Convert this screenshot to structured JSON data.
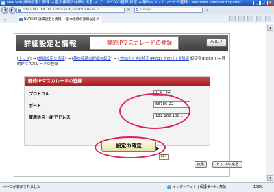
{
  "window": {
    "title": "NVR500 詳細設定と情報 → 基本接続の詳細な設定 → プロバイダの登録/修正 → 静的IPマスカレードの登録 - Windows Internet Explorer",
    "min": "_",
    "max": "□",
    "close": "×"
  },
  "addressbar": {
    "url": "http://192.168.100.1/detail/nat_addstrt?AHA3S=S",
    "search_placeholder": "Google",
    "search_glyph": "G"
  },
  "tab": {
    "label": "NVR500 詳細設定と情報 → 基本接続の詳細な設...",
    "close": "×"
  },
  "page": {
    "header_title": "詳細設定と情報",
    "header_subtitle": "静的IPマスカレードの登録",
    "help_label": "ヘルプ",
    "breadcrumb": {
      "open": "[",
      "top": "トップ",
      "sep1": "] → [",
      "detail": "詳細設定と情報",
      "sep2": "] → [",
      "basic": "基本接続の詳細な設定",
      "sep3": "] → [",
      "provider": "プロバイダの修正(PP01) プロバイダ接続",
      "tail": "設定名(DEE0)] → 静的IPマスカレードの登録"
    },
    "panel_title": "静的IPマスカレードの登録",
    "fields": {
      "protocol_label": "プロトコル",
      "protocol_value": "TCP",
      "port_label": "ポート",
      "port_value": "56785-22",
      "host_label": "使用ホストIPアドレス",
      "host_value": "192.168.100.1"
    },
    "confirm_label": "設定の確定",
    "cursor_tip": "GET",
    "back_label": "戻る",
    "top_label": "トップへ戻る"
  },
  "statusbar": {
    "left_text": "ページが表示されました",
    "zone_text": "インターネット | 保護モード: 無効",
    "zoom": "100%"
  },
  "colors": {
    "annotation": "#e0205a",
    "panel_header": "#b52a2a",
    "header_bg": "#4d4d4d",
    "link": "#1a3fc0"
  }
}
